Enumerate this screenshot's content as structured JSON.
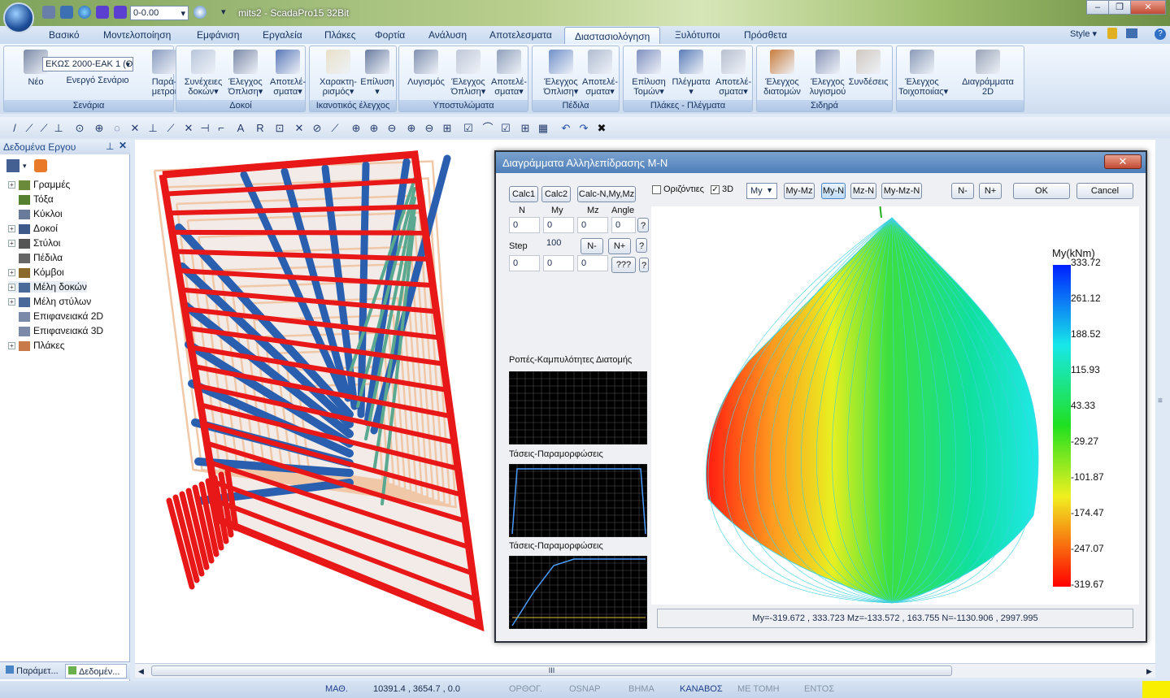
{
  "app": {
    "title": "mits2 - ScadaPro15 32Bit",
    "zoom_value": "0-0.00",
    "style_label": "Style"
  },
  "menu": [
    "Βασικό",
    "Μοντελοποίηση",
    "Εμφάνιση",
    "Εργαλεία",
    "Πλάκες",
    "Φορτία",
    "Ανάλυση",
    "Αποτελεσματα",
    "Διαστασιολόγηση",
    "Ξυλότυποι",
    "Πρόσθετα"
  ],
  "ribbon": {
    "code_select": "ΕΚΩΣ 2000-ΕΑΚ 1 (Ο",
    "groups": [
      {
        "label": "Σενάρια",
        "buttons": [
          {
            "l1": "Νέο",
            "l2": ""
          },
          {
            "l1": "Ενεργό Σενάριο",
            "l2": ""
          },
          {
            "l1": "Παρά-",
            "l2": "μετροι"
          }
        ]
      },
      {
        "label": "Δοκοί",
        "buttons": [
          {
            "l1": "Συνέχειες",
            "l2": "δοκών▾"
          },
          {
            "l1": "Έλεγχος",
            "l2": "Όπλιση▾"
          },
          {
            "l1": "Αποτελέ-",
            "l2": "σματα▾"
          }
        ]
      },
      {
        "label": "Ικανοτικός έλεγχος",
        "buttons": [
          {
            "l1": "Χαρακτη-",
            "l2": "ρισμός▾"
          },
          {
            "l1": "Επίλυση",
            "l2": "▾"
          }
        ]
      },
      {
        "label": "Υποστυλώματα",
        "buttons": [
          {
            "l1": "Λυγισμός",
            "l2": ""
          },
          {
            "l1": "Έλεγχος",
            "l2": "Όπλιση▾"
          },
          {
            "l1": "Αποτελέ-",
            "l2": "σματα▾"
          }
        ]
      },
      {
        "label": "Πέδιλα",
        "buttons": [
          {
            "l1": "Έλεγχος",
            "l2": "Όπλιση▾"
          },
          {
            "l1": "Αποτελέ-",
            "l2": "σματα▾"
          }
        ]
      },
      {
        "label": "Πλάκες - Πλέγματα",
        "buttons": [
          {
            "l1": "Επίλυση",
            "l2": "Τομών▾"
          },
          {
            "l1": "Πλέγματα",
            "l2": "▾"
          },
          {
            "l1": "Αποτελέ-",
            "l2": "σματα▾"
          }
        ]
      },
      {
        "label": "Σιδηρά",
        "buttons": [
          {
            "l1": "Έλεγχος",
            "l2": "διατομών"
          },
          {
            "l1": "Έλεγχος",
            "l2": "λυγισμού"
          },
          {
            "l1": "Συνδέσεις",
            "l2": ""
          }
        ]
      },
      {
        "label": "",
        "buttons": [
          {
            "l1": "Έλεγχος",
            "l2": "Τοιχοποιίας▾"
          },
          {
            "l1": "Διαγράμματα",
            "l2": "2D"
          }
        ]
      }
    ]
  },
  "tree": {
    "title": "Δεδομένα Εργου",
    "items": [
      "Γραμμές",
      "Τόξα",
      "Κύκλοι",
      "Δοκοί",
      "Στύλοι",
      "Πέδιλα",
      "Κόμβοι",
      "Μέλη δοκών",
      "Μέλη στύλων",
      "Επιφανειακά 2D",
      "Επιφανειακά 3D",
      "Πλάκες"
    ],
    "tabs": [
      "Παράμετ...",
      "Δεδομέν..."
    ]
  },
  "dialog": {
    "title": "Διαγράμματα Αλληλεπίδρασης M-N",
    "buttons": {
      "calc1": "Calc1",
      "calc2": "Calc2",
      "calc3": "Calc-N,My,Mz",
      "nminus": "N-",
      "nplus": "N+",
      "ask": "???",
      "q": "?"
    },
    "headers": [
      "N",
      "My",
      "Mz",
      "Angle"
    ],
    "row1": [
      "0",
      "0",
      "0",
      "0"
    ],
    "step_label": "Step",
    "step_value": "100",
    "row3": [
      "0",
      "0",
      "0"
    ],
    "horizontal": "Οριζόντιες",
    "threed": "3D",
    "axis_select": "My",
    "views": [
      "My-Mz",
      "My-N",
      "Mz-N",
      "My-Mz-N"
    ],
    "n_minus": "N-",
    "n_plus": "N+",
    "ok": "OK",
    "cancel": "Cancel",
    "section1": "Ροπές-Καμπυλότητες Διατομής",
    "section2": "Τάσεις-Παραμορφώσεις",
    "section3": "Τάσεις-Παραμορφώσεις",
    "legend_title": "My(kNm)",
    "legend_values": [
      "333.72",
      "261.12",
      "188.52",
      "115.93",
      "43.33",
      "-29.27",
      "-101.87",
      "-174.47",
      "-247.07",
      "-319.67"
    ],
    "status": "My=-319.672 , 333.723 Mz=-133.572 , 163.755 N=-1130.906 , 2997.995"
  },
  "statusbar": {
    "math": "ΜΑΘ.",
    "coords": "10391.4 , 3654.7 , 0.0",
    "items": [
      "ΟΡΘΟΓ.",
      "OSNAP",
      "ΒΗΜΑ",
      "ΚΑΝΑΒΟΣ",
      "ΜΕ ΤΟΜΗ",
      "ΕΝΤΟΣ"
    ]
  },
  "scroll_marker": "III"
}
